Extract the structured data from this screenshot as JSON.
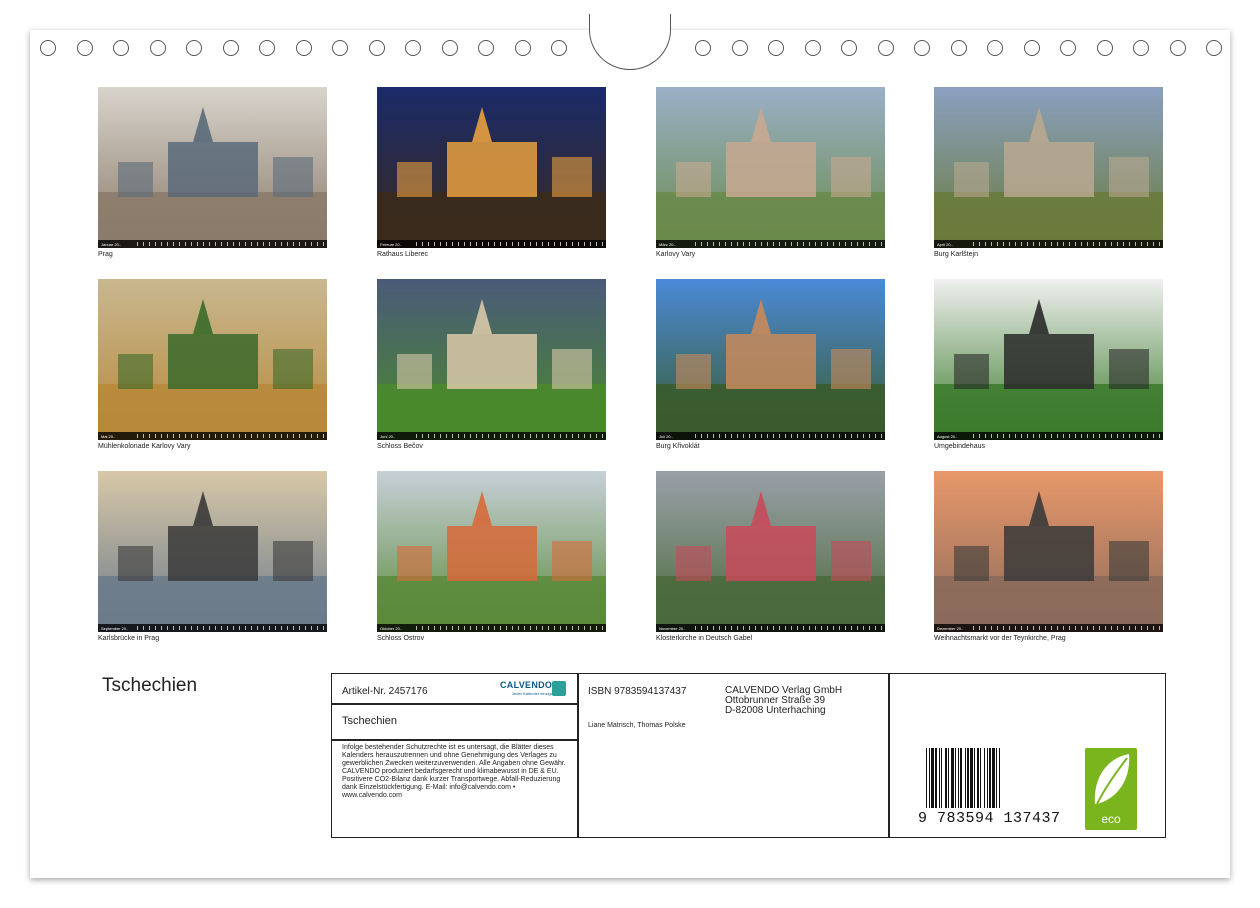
{
  "photos": [
    {
      "caption": "Prag",
      "month": "Januar 20..",
      "sky": "#d8d4cc",
      "ground": "#8a7a6a",
      "accent": "#5a6a7a"
    },
    {
      "caption": "Rathaus Liberec",
      "month": "Februar 20..",
      "sky": "#1a2a6a",
      "ground": "#3a2a1a",
      "accent": "#e8a040"
    },
    {
      "caption": "Karlovy Vary",
      "month": "März 20..",
      "sky": "#9ab0c8",
      "ground": "#6a8a4a",
      "accent": "#c8a890"
    },
    {
      "caption": "Burg Karlštejn",
      "month": "April 20..",
      "sky": "#8aa0c0",
      "ground": "#6a7a3a",
      "accent": "#b8a890"
    },
    {
      "caption": "Mühlenkolonade Karlovy Vary",
      "month": "Mai 20..",
      "sky": "#c8b890",
      "ground": "#b8883a",
      "accent": "#3a6a2a"
    },
    {
      "caption": "Schloss Bečov",
      "month": "Juni 20..",
      "sky": "#4a5a7a",
      "ground": "#4a8a2a",
      "accent": "#d8c8a8"
    },
    {
      "caption": "Burg Křivoklát",
      "month": "Juli 20..",
      "sky": "#4a8ad8",
      "ground": "#3a5a2a",
      "accent": "#c88a5a"
    },
    {
      "caption": "Umgebindehaus",
      "month": "August 20..",
      "sky": "#f0f0f0",
      "ground": "#3a7a2a",
      "accent": "#2a2a2a"
    },
    {
      "caption": "Karlsbrücke in Prag",
      "month": "September 20..",
      "sky": "#d8c8a8",
      "ground": "#6a7a8a",
      "accent": "#3a3a3a"
    },
    {
      "caption": "Schloss Ostrov",
      "month": "Oktober 20..",
      "sky": "#c8d0d8",
      "ground": "#5a8a3a",
      "accent": "#d86a3a"
    },
    {
      "caption": "Klosterkirche in Deutsch Gabel",
      "month": "November 20..",
      "sky": "#9aa0a8",
      "ground": "#4a6a3a",
      "accent": "#c84a5a"
    },
    {
      "caption": "Weihnachtsmarkt vor der Teynkirche, Prag",
      "month": "Dezember 20..",
      "sky": "#e8986a",
      "ground": "#8a6a5a",
      "accent": "#3a3a3a"
    }
  ],
  "cover_title": "Tschechien",
  "info": {
    "article": "Artikel-Nr. 2457176",
    "logo_brand": "CALVENDO",
    "logo_tag": "Jeder Kalender einzigartig",
    "title": "Tschechien",
    "legal": "Infolge bestehender Schutzrechte ist es untersagt, die Blätter dieses Kalenders herauszutrennen und ohne Genehmigung des Verlages zu gewerblichen Zwecken weiterzuverwenden. Alle Angaben ohne Gewähr. CALVENDO produziert bedarfsgerecht und klimabewusst in DE & EU. Positivere CO2-Bilanz dank kurzer Transportwege. Abfall-Reduzierung dank Einzelstückfertigung. E-Mail: info@calvendo.com • www.calvendo.com",
    "isbn": "ISBN 9783594137437",
    "authors": "Liane Matrisch, Thomas Polske",
    "publisher_name": "CALVENDO Verlag GmbH",
    "publisher_street": "Ottobrunner Straße 39",
    "publisher_city": "D-82008 Unterhaching",
    "barcode_digits": "9  783594  137437",
    "eco_label": "eco"
  }
}
